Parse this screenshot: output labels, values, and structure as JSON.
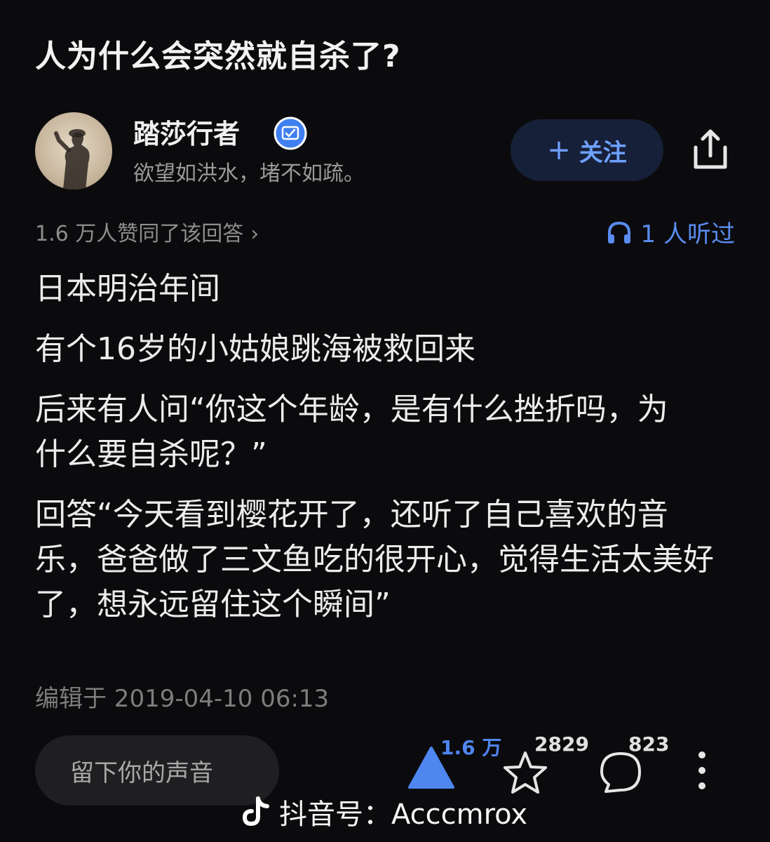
{
  "question": {
    "title": "人为什么会突然就自杀了?"
  },
  "author": {
    "name": "踏莎行者",
    "bio": "欲望如洪水，堵不如疏。",
    "follow_label": "关注",
    "follow_plus": "+"
  },
  "stats": {
    "upvote_summary": "1.6 万人赞同了该回答",
    "upvote_chevron": "›",
    "listen_text": "1 人听过"
  },
  "answer": {
    "paragraphs": [
      "日本明治年间",
      "有个16岁的小姑娘跳海被救回来",
      "后来有人问“你这个年龄，是有什么挫折吗，为什么要自杀呢？”",
      "回答“今天看到樱花开了，还听了自己喜欢的音乐，爸爸做了三文鱼吃的很开心，觉得生活太美好了，想永远留住这个瞬间”"
    ],
    "edited": "编辑于 2019-04-10 06:13"
  },
  "bottom_bar": {
    "comment_placeholder": "留下你的声音",
    "vote_count": "1.6 万",
    "favorite_count": "2829",
    "comment_count": "823"
  },
  "watermark": {
    "text": "抖音号：Acccmrox"
  },
  "colors": {
    "background": "#0b0b0d",
    "accent": "#4f86f0",
    "follow_bg": "#162038"
  },
  "icons": [
    "verified-icon",
    "share-icon",
    "headphone-icon",
    "upvote-icon",
    "star-icon",
    "comment-icon",
    "more-icon",
    "tiktok-logo-icon"
  ]
}
